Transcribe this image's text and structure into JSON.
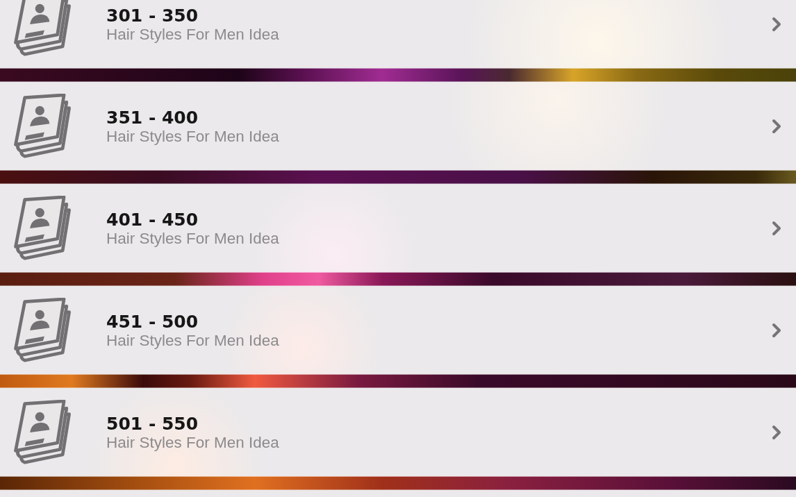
{
  "list": {
    "items": [
      {
        "title": "301 - 350",
        "subtitle": "Hair Styles For Men Idea"
      },
      {
        "title": "351 - 400",
        "subtitle": "Hair Styles For Men Idea"
      },
      {
        "title": "401 - 450",
        "subtitle": "Hair Styles For Men Idea"
      },
      {
        "title": "451 - 500",
        "subtitle": "Hair Styles For Men Idea"
      },
      {
        "title": "501 - 550",
        "subtitle": "Hair Styles For Men Idea"
      }
    ]
  }
}
